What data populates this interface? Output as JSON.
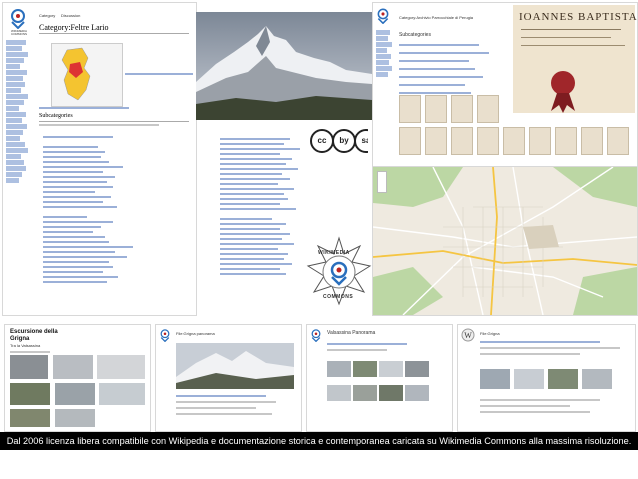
{
  "caption": "Dal 2006 licenza libera compatibile con Wikipedia e documentazione storica e contemporanea caricata su Wikimedia Commons alla massima risoluzione.",
  "category_page": {
    "tabs": [
      "Category",
      "Discussion"
    ],
    "title": "Category:Feltre Lario",
    "section": "Subcategories",
    "logo_text": "WIKIMEDIA COMMONS"
  },
  "document_page": {
    "title": "Category:Archivio Parrocchiale di Perugia",
    "header": "Subcategories",
    "manuscript_heading": "IOANNES BAPTISTA"
  },
  "badge": {
    "top_text": "WIKIMEDIA",
    "bottom_text": "COMMONS",
    "cc_icons": [
      "cc",
      "by",
      "sa"
    ]
  },
  "bottom_pages": [
    {
      "title": "Escursione della Grigna",
      "subtitle": "Tra la Valsassina"
    },
    {
      "title": "File:Grigna panorama"
    },
    {
      "title": "Valsassina Panorama"
    },
    {
      "title": "File:Grigna"
    }
  ],
  "colors": {
    "link": "#2a4fb0",
    "caption_bg": "#000000",
    "map_green": "#bcd7a4"
  }
}
